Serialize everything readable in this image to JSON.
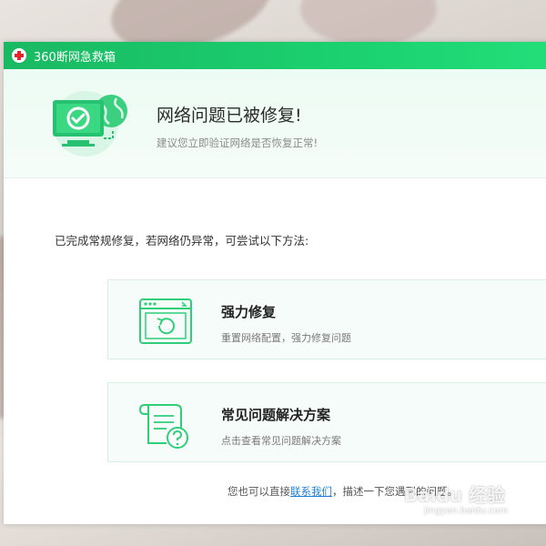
{
  "window": {
    "title": "360断网急救箱"
  },
  "banner": {
    "title": "网络问题已被修复!",
    "subtitle": "建议您立即验证网络是否恢复正常!",
    "icon": "monitor-globe-check-icon"
  },
  "hint": "已完成常规修复，若网络仍异常，可尝试以下方法:",
  "options": [
    {
      "title": "强力修复",
      "desc": "重置网络配置，强力修复问题",
      "icon": "window-refresh-icon"
    },
    {
      "title": "常见问题解决方案",
      "desc": "点击查看常见问题解决方案",
      "icon": "document-question-icon"
    }
  ],
  "footer": {
    "prefix": "您也可以直接",
    "link": "联系我们",
    "suffix": "，描述一下您遇到的问题。"
  },
  "watermark": {
    "text": "Baidu 经验",
    "sub": "jingyan.baidu.com"
  },
  "colors": {
    "titlebar": "#1bd06f",
    "accent": "#2fcf7a",
    "link": "#1f7fd6"
  }
}
